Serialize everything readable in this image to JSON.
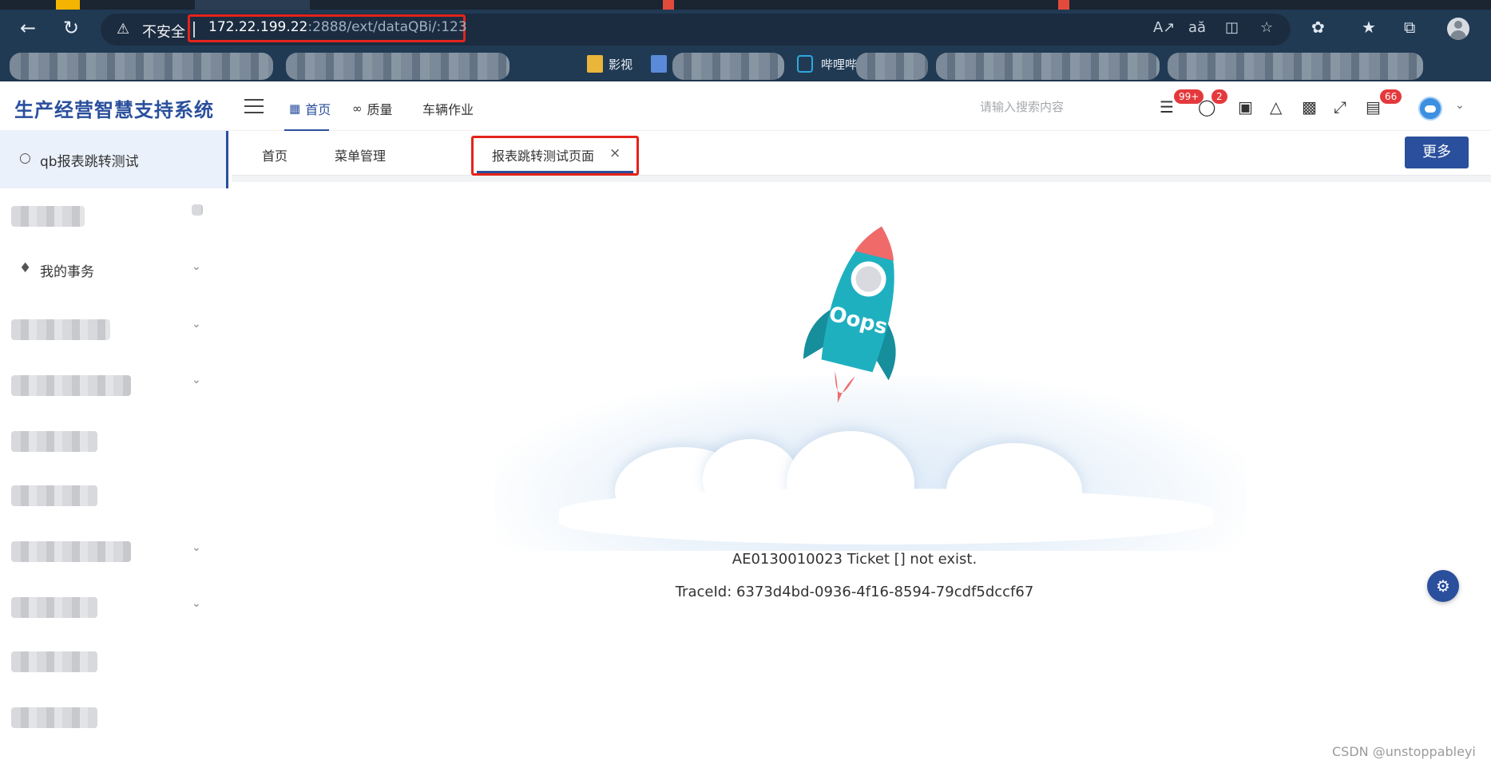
{
  "browser": {
    "security_label": "不安全",
    "url_host": "172.22.199.22",
    "url_rest": ":2888/ext/dataQBi/:123",
    "bookmarks": [
      "影视",
      "哔哩哔"
    ]
  },
  "app": {
    "title": "生产经营智慧支持系统",
    "topnav": [
      {
        "label": "首页",
        "icon": "grid-icon",
        "active": true
      },
      {
        "label": "质量",
        "icon": "glasses-icon",
        "active": false
      },
      {
        "label": "车辆作业",
        "icon": "",
        "active": false
      }
    ],
    "search_placeholder": "请输入搜索内容",
    "badges": {
      "messages": "99+",
      "alerts": "2",
      "tasks": "66"
    }
  },
  "sidebar": {
    "active_item": "qb报表跳转测试",
    "items": [
      {
        "label": "我的事务",
        "icon": "bell-icon",
        "expandable": true
      }
    ]
  },
  "tabs": {
    "items": [
      "首页",
      "菜单管理",
      "报表跳转测试页面"
    ],
    "close_glyph": "×",
    "more_label": "更多"
  },
  "error": {
    "rocket_text": "Oops",
    "message": "AE0130010023 Ticket [] not exist.",
    "trace": "TraceId: 6373d4bd-0936-4f16-8594-79cdf5dccf67"
  },
  "watermark": "CSDN @unstoppableyi",
  "colors": {
    "brand": "#2a4f9c",
    "badge": "#e4393c",
    "highlight": "#e3241b",
    "rocket_body": "#1fb0c0",
    "rocket_flame": "#f06a6a"
  }
}
